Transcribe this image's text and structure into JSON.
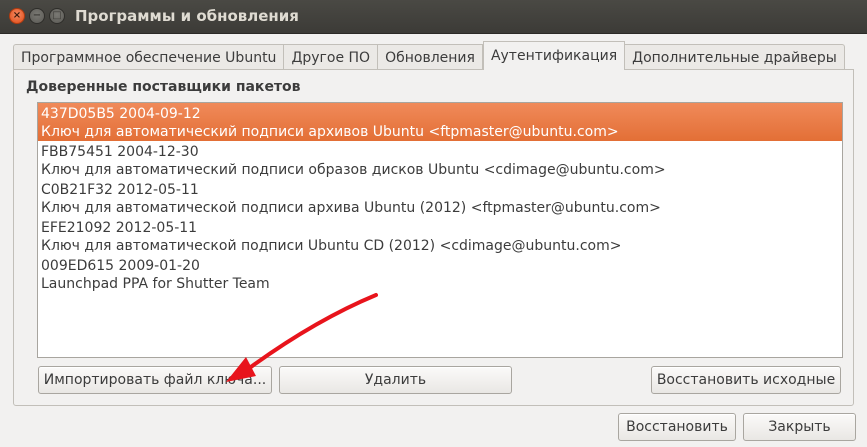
{
  "window": {
    "title": "Программы и обновления",
    "close_glyph": "×",
    "minimize_glyph": "−",
    "maximize_glyph": "□"
  },
  "tabs": [
    {
      "label": "Программное обеспечение Ubuntu",
      "active": false
    },
    {
      "label": "Другое ПО",
      "active": false
    },
    {
      "label": "Обновления",
      "active": false
    },
    {
      "label": "Аутентификация",
      "active": true
    },
    {
      "label": "Дополнительные драйверы",
      "active": false
    }
  ],
  "authentication": {
    "section_label": "Доверенные поставщики пакетов",
    "keys": [
      {
        "id_date": "437D05B5 2004-09-12",
        "description": "Ключ для автоматический подписи архивов Ubuntu <ftpmaster@ubuntu.com>",
        "selected": true
      },
      {
        "id_date": "FBB75451 2004-12-30",
        "description": "Ключ для автоматический подписи образов дисков Ubuntu <cdimage@ubuntu.com>",
        "selected": false
      },
      {
        "id_date": "C0B21F32 2012-05-11",
        "description": "Ключ для автоматической подписи архива Ubuntu (2012) <ftpmaster@ubuntu.com>",
        "selected": false
      },
      {
        "id_date": "EFE21092 2012-05-11",
        "description": "Ключ для автоматической подписи Ubuntu CD (2012) <cdimage@ubuntu.com>",
        "selected": false
      },
      {
        "id_date": "009ED615 2009-01-20",
        "description": "Launchpad PPA for Shutter Team",
        "selected": false
      }
    ],
    "import_button": "Импортировать файл ключа...",
    "delete_button": "Удалить",
    "restore_defaults_button": "Восстановить исходные"
  },
  "footer": {
    "revert_button": "Восстановить",
    "close_button": "Закрыть"
  },
  "colors": {
    "selection": "#e36f36",
    "annotation_arrow": "#e8141c"
  }
}
